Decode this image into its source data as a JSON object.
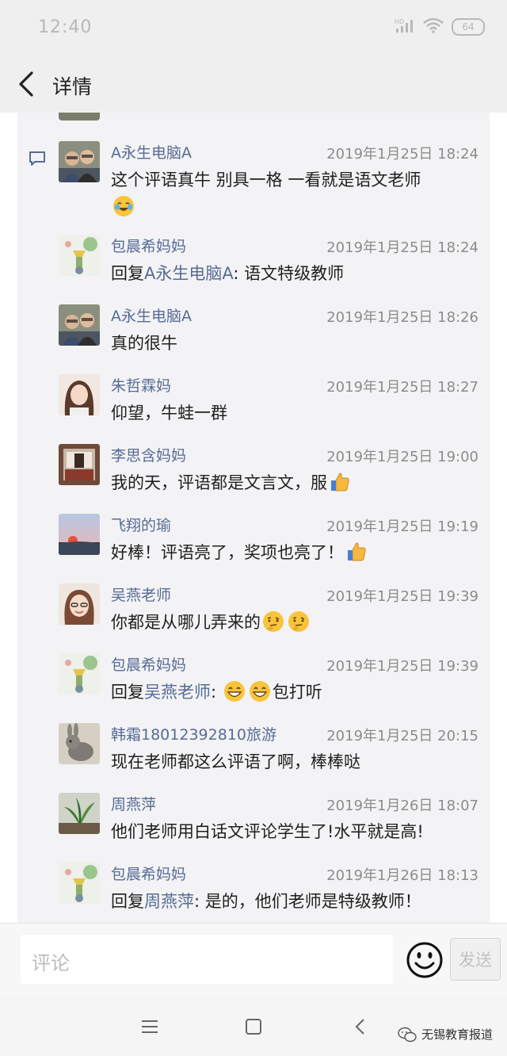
{
  "status_bar": {
    "time": "12:40",
    "signal": "HD",
    "battery": "64"
  },
  "nav": {
    "title": "详情"
  },
  "comments": [
    {
      "name": "A永生电脑A",
      "time": "2019年1月25日 18:24",
      "text": "这个评语真牛 别具一格 一看就是语文老师",
      "avatar": "couple-photo"
    },
    {
      "name": "包晨希妈妈",
      "time": "2019年1月25日 18:24",
      "reply_prefix": "回复",
      "reply_to": "A永生电脑A",
      "text": ": 语文特级教师",
      "avatar": "cartoon-figure"
    },
    {
      "name": "A永生电脑A",
      "time": "2019年1月25日 18:26",
      "text": "真的很牛",
      "avatar": "couple-photo"
    },
    {
      "name": "朱哲霖妈",
      "time": "2019年1月25日 18:27",
      "text": "仰望，牛蛙一群",
      "avatar": "woman-portrait"
    },
    {
      "name": "李思含妈妈",
      "time": "2019年1月25日 19:00",
      "text": "我的天，评语都是文言文，服",
      "avatar": "room-photo"
    },
    {
      "name": "飞翔的瑜",
      "time": "2019年1月25日 19:19",
      "text": "好棒！评语亮了，奖项也亮了！",
      "avatar": "sunset-landscape"
    },
    {
      "name": "吴燕老师",
      "time": "2019年1月25日 19:39",
      "text": "你都是从哪儿弄来的",
      "avatar": "woman-glasses"
    },
    {
      "name": "包晨希妈妈",
      "time": "2019年1月25日 19:39",
      "reply_prefix": "回复",
      "reply_to": "吴燕老师",
      "text": ":",
      "text_after": "包打听",
      "avatar": "cartoon-figure"
    },
    {
      "name": "韩霜18012392810旅游",
      "time": "2019年1月25日 20:15",
      "text": "现在老师都这么评语了啊，棒棒哒",
      "avatar": "rabbit-photo"
    },
    {
      "name": "周燕萍",
      "time": "2019年1月26日 18:07",
      "text": "他们老师用白话文评论学生了!水平就是高!",
      "avatar": "plant-photo"
    },
    {
      "name": "包晨希妈妈",
      "time": "2019年1月26日 18:13",
      "reply_prefix": "回复",
      "reply_to": "周燕萍",
      "text": ": 是的，他们老师是特级教师！",
      "avatar": "cartoon-figure"
    }
  ],
  "input": {
    "placeholder": "评论",
    "send_label": "发送"
  },
  "watermark": {
    "text": "无锡教育报道"
  },
  "colors": {
    "link": "#576b95",
    "time": "#8c8c8c",
    "panel": "#f3f3f5"
  }
}
